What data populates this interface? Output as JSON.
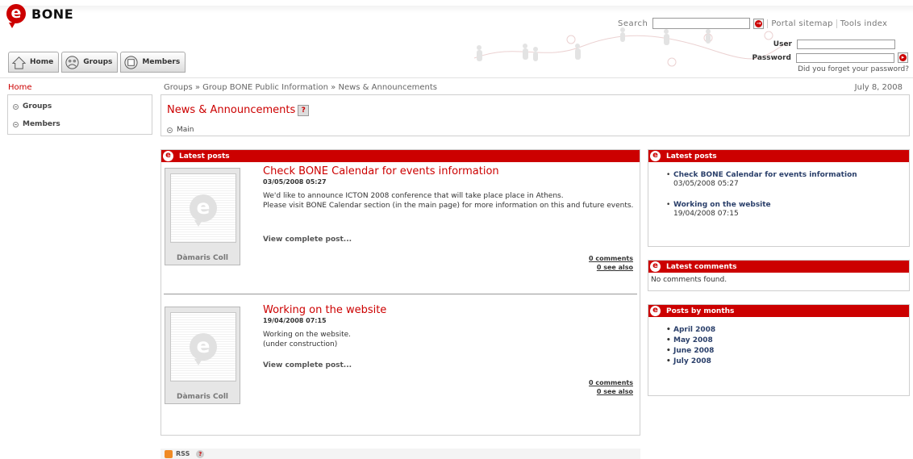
{
  "header": {
    "logo_text": "BONE",
    "search_label": "Search",
    "search_placeholder": "",
    "portal_sitemap": "Portal sitemap",
    "tools_index": "Tools index",
    "user_label": "User",
    "password_label": "Password",
    "forgot_password": "Did you forget your password?"
  },
  "nav": {
    "tabs": [
      {
        "label": "Home"
      },
      {
        "label": "Groups"
      },
      {
        "label": "Members"
      }
    ]
  },
  "breadcrumb": {
    "home": "Home",
    "groups": "Groups",
    "group": "Group BONE Public Information",
    "current": "News & Announcements",
    "separator": "»",
    "date": "July 8, 2008"
  },
  "sidebar": {
    "items": [
      {
        "label": "Groups"
      },
      {
        "label": "Members"
      }
    ]
  },
  "page": {
    "title": "News & Announcements",
    "help": "?",
    "main_link": "Main"
  },
  "posts_panel": {
    "title": "Latest posts",
    "posts": [
      {
        "title": "Check BONE Calendar for events information",
        "date": "03/05/2008 05:27",
        "body_line1": "We'd like to announce ICTON 2008 conference that  will take place place in Athens.",
        "body_line2": "Please visit BONE Calendar section (in the main page) for more information on this and future events.",
        "view": "View complete post...",
        "author": "Dàmaris Coll",
        "comments": "0 comments",
        "see_also": "0 see also"
      },
      {
        "title": "Working on the website",
        "date": "19/04/2008 07:15",
        "body_line1": "Working on the website.",
        "body_line2": "(under construction)",
        "view": "View complete post...",
        "author": "Dàmaris Coll",
        "comments": "0 comments",
        "see_also": "0 see also"
      }
    ]
  },
  "rss": {
    "label": "RSS",
    "help": "?"
  },
  "right": {
    "latest_posts": {
      "title": "Latest posts",
      "items": [
        {
          "title": "Check BONE Calendar for events information",
          "date": "03/05/2008 05:27"
        },
        {
          "title": "Working on the website",
          "date": "19/04/2008 07:15"
        }
      ]
    },
    "latest_comments": {
      "title": "Latest comments",
      "empty": "No comments found."
    },
    "posts_by_months": {
      "title": "Posts by months",
      "months": [
        "April 2008",
        "May 2008",
        "June 2008",
        "July 2008"
      ]
    }
  },
  "colors": {
    "brand_red": "#cc0000",
    "link_blue": "#2a3f6a"
  },
  "icons": {
    "logo": "bone-e-logo-icon",
    "home": "home-icon",
    "groups": "groups-icon",
    "members": "members-icon",
    "go": "arrow-right-icon",
    "rss": "rss-icon"
  }
}
